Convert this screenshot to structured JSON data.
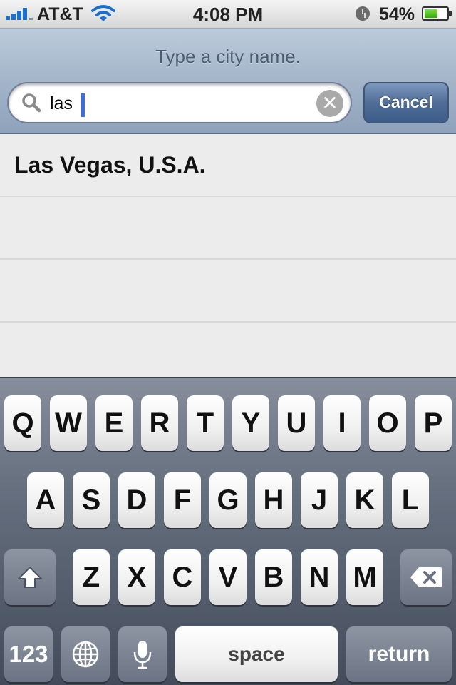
{
  "status_bar": {
    "carrier": "AT&T",
    "time": "4:08 PM",
    "battery_percent": "54%",
    "battery_level": 0.54,
    "signal_bars": 4
  },
  "search": {
    "prompt": "Type a city name.",
    "value": "las",
    "cancel_label": "Cancel",
    "clear_glyph": "✕"
  },
  "results": [
    {
      "label": "Las Vegas, U.S.A."
    },
    {
      "label": ""
    },
    {
      "label": ""
    },
    {
      "label": ""
    }
  ],
  "keyboard": {
    "row1": [
      "Q",
      "W",
      "E",
      "R",
      "T",
      "Y",
      "U",
      "I",
      "O",
      "P"
    ],
    "row2": [
      "A",
      "S",
      "D",
      "F",
      "G",
      "H",
      "J",
      "K",
      "L"
    ],
    "row3": [
      "Z",
      "X",
      "C",
      "V",
      "B",
      "N",
      "M"
    ],
    "numbers_label": "123",
    "space_label": "space",
    "return_label": "return",
    "icons": {
      "shift": "shift-icon",
      "delete": "backspace-icon",
      "globe": "globe-icon",
      "mic": "microphone-icon"
    }
  },
  "colors": {
    "accent": "#4f6d97",
    "caret": "#3c6ee8"
  }
}
